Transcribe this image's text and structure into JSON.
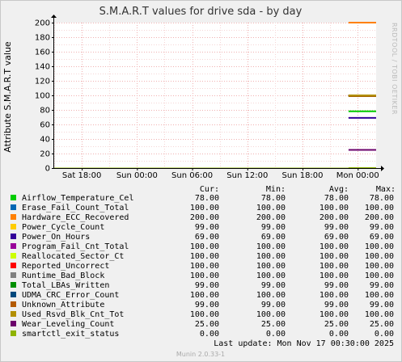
{
  "chart_data": {
    "type": "line",
    "title": "S.M.A.R.T values for drive sda - by day",
    "ylabel": "Attribute S.M.A.R.T value",
    "side_label": "RRDTOOL / TOBI OETIKER",
    "ylim": [
      0,
      200
    ],
    "y_ticks": [
      0,
      20,
      40,
      60,
      80,
      100,
      120,
      140,
      160,
      180,
      200
    ],
    "x_ticks": [
      "Sat 18:00",
      "Sun 00:00",
      "Sun 06:00",
      "Sun 12:00",
      "Sun 18:00",
      "Mon 00:00"
    ],
    "x_tick_hours": [
      0,
      6,
      12,
      18,
      24,
      30
    ],
    "x_range_hours": [
      -3,
      32
    ],
    "data_start_hour": 29,
    "data_end_hour": 32,
    "grid": true,
    "legend_headers": [
      "Cur:",
      "Min:",
      "Avg:",
      "Max:"
    ],
    "series": [
      {
        "name": "Airflow_Temperature_Cel",
        "color": "#00cc00",
        "cur": "78.00",
        "min": "78.00",
        "avg": "78.00",
        "max": "78.00",
        "value": 78
      },
      {
        "name": "Erase_Fail_Count_Total",
        "color": "#0066b3",
        "cur": "100.00",
        "min": "100.00",
        "avg": "100.00",
        "max": "100.00",
        "value": 100
      },
      {
        "name": "Hardware_ECC_Recovered",
        "color": "#ff8000",
        "cur": "200.00",
        "min": "200.00",
        "avg": "200.00",
        "max": "200.00",
        "value": 200
      },
      {
        "name": "Power_Cycle_Count",
        "color": "#ffcc00",
        "cur": "99.00",
        "min": "99.00",
        "avg": "99.00",
        "max": "99.00",
        "value": 99
      },
      {
        "name": "Power_On_Hours",
        "color": "#330099",
        "cur": "69.00",
        "min": "69.00",
        "avg": "69.00",
        "max": "69.00",
        "value": 69
      },
      {
        "name": "Program_Fail_Cnt_Total",
        "color": "#990099",
        "cur": "100.00",
        "min": "100.00",
        "avg": "100.00",
        "max": "100.00",
        "value": 100
      },
      {
        "name": "Reallocated_Sector_Ct",
        "color": "#ccff00",
        "cur": "100.00",
        "min": "100.00",
        "avg": "100.00",
        "max": "100.00",
        "value": 100
      },
      {
        "name": "Reported_Uncorrect",
        "color": "#ff0000",
        "cur": "100.00",
        "min": "100.00",
        "avg": "100.00",
        "max": "100.00",
        "value": 100
      },
      {
        "name": "Runtime_Bad_Block",
        "color": "#808080",
        "cur": "100.00",
        "min": "100.00",
        "avg": "100.00",
        "max": "100.00",
        "value": 100
      },
      {
        "name": "Total_LBAs_Written",
        "color": "#008f00",
        "cur": "99.00",
        "min": "99.00",
        "avg": "99.00",
        "max": "99.00",
        "value": 99
      },
      {
        "name": "UDMA_CRC_Error_Count",
        "color": "#00487d",
        "cur": "100.00",
        "min": "100.00",
        "avg": "100.00",
        "max": "100.00",
        "value": 100
      },
      {
        "name": "Unknown_Attribute",
        "color": "#b35a00",
        "cur": "99.00",
        "min": "99.00",
        "avg": "99.00",
        "max": "99.00",
        "value": 99
      },
      {
        "name": "Used_Rsvd_Blk_Cnt_Tot",
        "color": "#b38f00",
        "cur": "100.00",
        "min": "100.00",
        "avg": "100.00",
        "max": "100.00",
        "value": 100
      },
      {
        "name": "Wear_Leveling_Count",
        "color": "#6b006b",
        "cur": "25.00",
        "min": "25.00",
        "avg": "25.00",
        "max": "25.00",
        "value": 25
      },
      {
        "name": "smartctl_exit_status",
        "color": "#8fb300",
        "cur": "0.00",
        "min": "0.00",
        "avg": "0.00",
        "max": "0.00",
        "value": 0
      }
    ]
  },
  "footer": {
    "last_update": "Last update:  Mon Nov 17 00:30:00 2025",
    "munin_version": "Munin 2.0.33-1"
  }
}
